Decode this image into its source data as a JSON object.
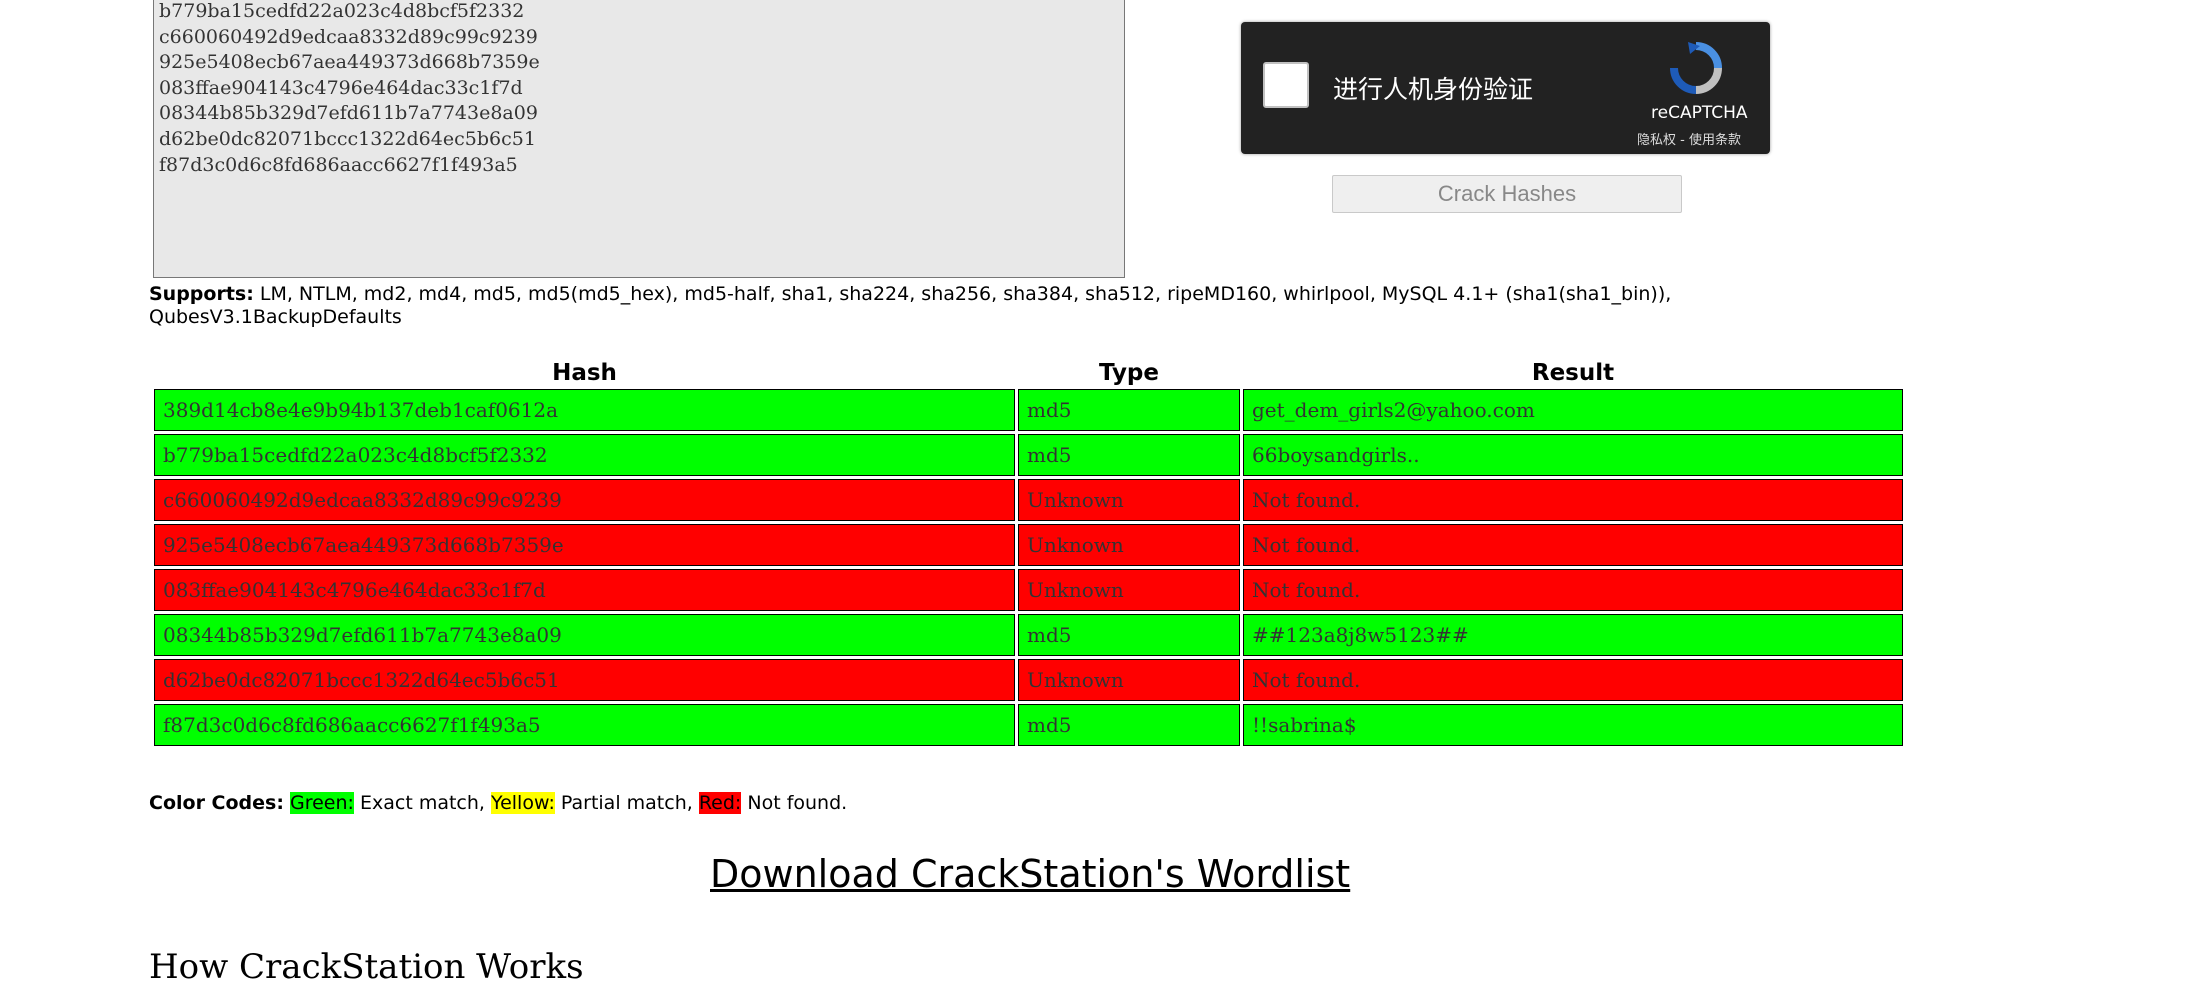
{
  "hash_input": {
    "lines": [
      "b779ba15cedfd22a023c4d8bcf5f2332",
      "c660060492d9edcaa8332d89c99c9239",
      "925e5408ecb67aea449373d668b7359e",
      "083ffae904143c4796e464dac33c1f7d",
      "08344b85b329d7efd611b7a7743e8a09",
      "d62be0dc82071bccc1322d64ec5b6c51",
      "f87d3c0d6c8fd686aacc6627f1f493a5"
    ]
  },
  "captcha": {
    "label": "进行人机身份验证",
    "brand": "reCAPTCHA",
    "privacy": "隐私权",
    "separator": " - ",
    "terms": "使用条款"
  },
  "crack_button": {
    "label": "Crack Hashes"
  },
  "supports": {
    "label": "Supports:",
    "text": " LM, NTLM, md2, md4, md5, md5(md5_hex), md5-half, sha1, sha224, sha256, sha384, sha512, ripeMD160, whirlpool, MySQL 4.1+ (sha1(sha1_bin)), QubesV3.1BackupDefaults"
  },
  "results_table": {
    "headers": {
      "hash": "Hash",
      "type": "Type",
      "result": "Result"
    },
    "rows": [
      {
        "hash": "389d14cb8e4e9b94b137deb1caf0612a",
        "type": "md5",
        "result": "get_dem_girls2@yahoo.com",
        "status": "green"
      },
      {
        "hash": "b779ba15cedfd22a023c4d8bcf5f2332",
        "type": "md5",
        "result": "66boysandgirls..",
        "status": "green"
      },
      {
        "hash": "c660060492d9edcaa8332d89c99c9239",
        "type": "Unknown",
        "result": "Not found.",
        "status": "red"
      },
      {
        "hash": "925e5408ecb67aea449373d668b7359e",
        "type": "Unknown",
        "result": "Not found.",
        "status": "red"
      },
      {
        "hash": "083ffae904143c4796e464dac33c1f7d",
        "type": "Unknown",
        "result": "Not found.",
        "status": "red"
      },
      {
        "hash": "08344b85b329d7efd611b7a7743e8a09",
        "type": "md5",
        "result": "##123a8j8w5123##",
        "status": "green"
      },
      {
        "hash": "d62be0dc82071bccc1322d64ec5b6c51",
        "type": "Unknown",
        "result": "Not found.",
        "status": "red"
      },
      {
        "hash": "f87d3c0d6c8fd686aacc6627f1f493a5",
        "type": "md5",
        "result": "!!sabrina$",
        "status": "green"
      }
    ]
  },
  "color_codes": {
    "label": "Color Codes:",
    "green": "Green:",
    "green_desc": " Exact match, ",
    "yellow": "Yellow:",
    "yellow_desc": " Partial match, ",
    "red": "Red:",
    "red_desc": " Not found."
  },
  "download_link": "Download CrackStation's Wordlist",
  "how_heading": "How CrackStation Works",
  "colors": {
    "green": "#00ff00",
    "red": "#ff0000",
    "yellow": "#ffff00",
    "captcha_bg": "#222222"
  }
}
